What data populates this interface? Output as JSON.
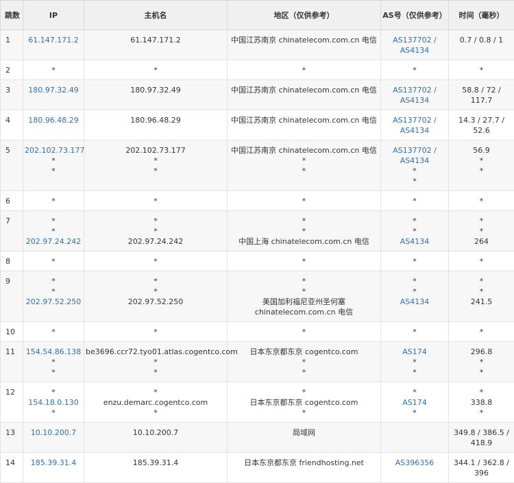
{
  "headers": {
    "hop": "跳数",
    "ip": "IP",
    "host": "主机名",
    "location": "地区（仅供参考）",
    "as": "AS号（仅供参考）",
    "time": "时间（毫秒）"
  },
  "rows": [
    {
      "hop": "1",
      "ip": [
        "61.147.171.2"
      ],
      "host": [
        "61.147.171.2"
      ],
      "loc": [
        "中国江苏南京 chinatelecom.com.cn 电信"
      ],
      "as": [
        "AS137702 /",
        "AS4134"
      ],
      "time": [
        "0.7 / 0.8 / 1"
      ]
    },
    {
      "hop": "2",
      "ip": [
        "*"
      ],
      "host": [
        "*"
      ],
      "loc": [
        "*"
      ],
      "as": [
        "*"
      ],
      "time": [
        "*"
      ]
    },
    {
      "hop": "3",
      "ip": [
        "180.97.32.49"
      ],
      "host": [
        "180.97.32.49"
      ],
      "loc": [
        "中国江苏南京 chinatelecom.com.cn 电信"
      ],
      "as": [
        "AS137702 /",
        "AS4134"
      ],
      "time": [
        "58.8 / 72 / 117.7"
      ]
    },
    {
      "hop": "4",
      "ip": [
        "180.96.48.29"
      ],
      "host": [
        "180.96.48.29"
      ],
      "loc": [
        "中国江苏南京 chinatelecom.com.cn 电信"
      ],
      "as": [
        "AS137702 /",
        "AS4134"
      ],
      "time": [
        "14.3 / 27.7 /",
        "52.6"
      ]
    },
    {
      "hop": "5",
      "ip": [
        "202.102.73.177",
        "*",
        "*"
      ],
      "host": [
        "202.102.73.177",
        "*",
        "*"
      ],
      "loc": [
        "中国江苏南京 chinatelecom.com.cn 电信",
        "*",
        "*"
      ],
      "as": [
        "AS137702 /",
        "AS4134",
        "*",
        "*"
      ],
      "time": [
        "56.9",
        "*",
        "*"
      ]
    },
    {
      "hop": "6",
      "ip": [
        "*"
      ],
      "host": [
        "*"
      ],
      "loc": [
        "*"
      ],
      "as": [
        "*"
      ],
      "time": [
        "*"
      ]
    },
    {
      "hop": "7",
      "ip": [
        "*",
        "*",
        "202.97.24.242"
      ],
      "host": [
        "*",
        "*",
        "202.97.24.242"
      ],
      "loc": [
        "*",
        "*",
        "中国上海 chinatelecom.com.cn 电信"
      ],
      "as": [
        "*",
        "*",
        "AS4134"
      ],
      "time": [
        "*",
        "*",
        "264"
      ]
    },
    {
      "hop": "8",
      "ip": [
        "*"
      ],
      "host": [
        "*"
      ],
      "loc": [
        "*"
      ],
      "as": [
        "*"
      ],
      "time": [
        "*"
      ]
    },
    {
      "hop": "9",
      "ip": [
        "*",
        "*",
        "202.97.52.250"
      ],
      "host": [
        "*",
        "*",
        "202.97.52.250"
      ],
      "loc": [
        "*",
        "*",
        "美国加利福尼亚州圣何塞 chinatelecom.com.cn 电信"
      ],
      "as": [
        "*",
        "*",
        "AS4134"
      ],
      "time": [
        "*",
        "*",
        "241.5"
      ]
    },
    {
      "hop": "10",
      "ip": [
        "*"
      ],
      "host": [
        "*"
      ],
      "loc": [
        "*"
      ],
      "as": [
        "*"
      ],
      "time": [
        "*"
      ]
    },
    {
      "hop": "11",
      "ip": [
        "154.54.86.138",
        "*",
        "*"
      ],
      "host": [
        "be3696.ccr72.tyo01.atlas.cogentco.com",
        "*",
        "*"
      ],
      "loc": [
        "日本东京都东京 cogentco.com",
        "*",
        "*"
      ],
      "as": [
        "AS174",
        "*",
        "*"
      ],
      "time": [
        "296.8",
        "*",
        "*"
      ]
    },
    {
      "hop": "12",
      "ip": [
        "*",
        "154.18.0.130",
        "*"
      ],
      "host": [
        "*",
        "enzu.demarc.cogentco.com",
        "*"
      ],
      "loc": [
        "*",
        "日本东京都东京 cogentco.com",
        "*"
      ],
      "as": [
        "*",
        "AS174",
        "*"
      ],
      "time": [
        "*",
        "338.8",
        "*"
      ]
    },
    {
      "hop": "13",
      "ip": [
        "10.10.200.7"
      ],
      "host": [
        "10.10.200.7"
      ],
      "loc": [
        "局域网"
      ],
      "as": [],
      "time": [
        "349.8 / 386.5 /",
        "418.9"
      ]
    },
    {
      "hop": "14",
      "ip": [
        "185.39.31.4"
      ],
      "host": [
        "185.39.31.4"
      ],
      "loc": [
        "日本东京都东京 friendhosting.net"
      ],
      "as": [
        "AS396356"
      ],
      "time": [
        "344.1 / 362.8 /",
        "396"
      ]
    }
  ]
}
